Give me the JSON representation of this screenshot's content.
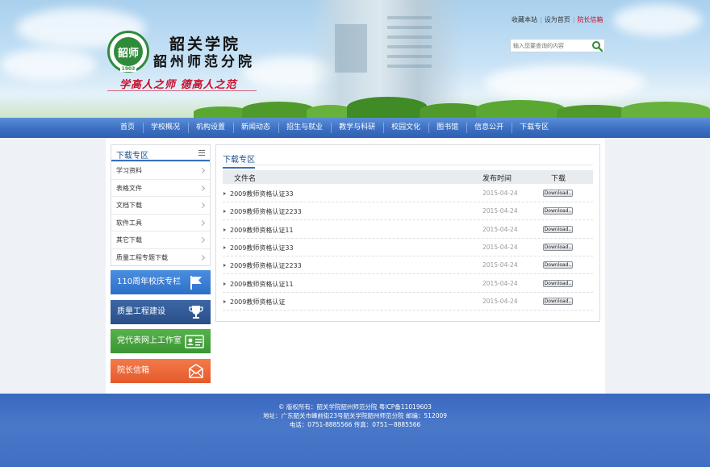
{
  "header": {
    "logo_text": "韶师",
    "logo_year": "1903",
    "school_name": "韶关学院",
    "branch_name": "韶州师范分院",
    "motto": "学高人之师  德高人之范",
    "top_links": [
      "收藏本站",
      "设为首页",
      "院长信箱"
    ],
    "search_placeholder": "输入您要查询的内容"
  },
  "nav": [
    "首页",
    "学校概况",
    "机构设置",
    "新闻动态",
    "招生与就业",
    "教学与科研",
    "校园文化",
    "图书馆",
    "信息公开",
    "下载专区"
  ],
  "sidebar": {
    "title": "下载专区",
    "items": [
      "学习资料",
      "表格文件",
      "文档下载",
      "软件工具",
      "其它下载",
      "质量工程专题下载"
    ],
    "banners": [
      "110周年校庆专栏",
      "质量工程建设",
      "党代表网上工作室",
      "院长信箱"
    ]
  },
  "main": {
    "title": "下载专区",
    "columns": [
      "文件名",
      "发布时间",
      "下载"
    ],
    "download_label": "Download..",
    "rows": [
      {
        "name": "2009教师资格认证33",
        "date": "2015-04-24"
      },
      {
        "name": "2009教师资格认证2233",
        "date": "2015-04-24"
      },
      {
        "name": "2009教师资格认证11",
        "date": "2015-04-24"
      },
      {
        "name": "2009教师资格认证33",
        "date": "2015-04-24"
      },
      {
        "name": "2009教师资格认证2233",
        "date": "2015-04-24"
      },
      {
        "name": "2009教师资格认证11",
        "date": "2015-04-24"
      },
      {
        "name": "2009教师资格认证",
        "date": "2015-04-24"
      }
    ]
  },
  "footer": {
    "line1": "© 版权所有：韶关学院韶州师范分院  粤ICP备11019603",
    "line2": "地址：广东韶关市峰前街23号韶关学院韶州师范分院  邮编：512009",
    "line3": "电话：0751-8885566  传真：0751－8885566"
  }
}
